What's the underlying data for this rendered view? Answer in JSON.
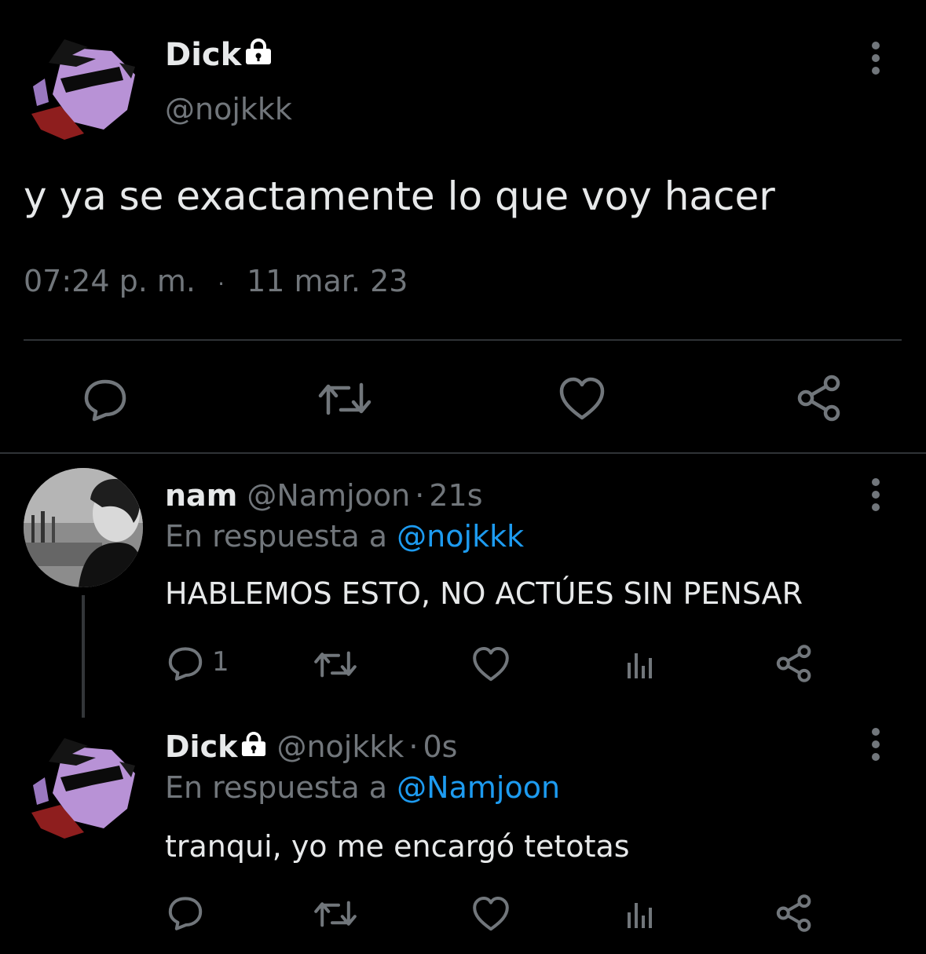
{
  "main_tweet": {
    "display_name": "Dick",
    "handle": "@nojkkk",
    "text": "y ya se exactamente lo que voy hacer",
    "time": "07:24 p. m.",
    "separator": "·",
    "date": "11 mar. 23",
    "avatar_icon": "robin-cartoon-avatar",
    "protected_icon": "lock-icon"
  },
  "main_actions": {
    "icons": [
      "reply-icon",
      "retweet-icon",
      "like-icon",
      "share-icon"
    ]
  },
  "reply1": {
    "display_name": "nam",
    "handle": "@Namjoon",
    "separator": "·",
    "age": "21s",
    "in_reply_prefix": "En respuesta a",
    "in_reply_handle": "@nojkkk",
    "text": "HABLEMOS ESTO, NO ACTÚES SIN PENSAR",
    "reply_count": "1",
    "avatar_icon": "grayscale-photo-avatar"
  },
  "reply2": {
    "display_name": "Dick",
    "handle": "@nojkkk",
    "separator": "·",
    "age": "0s",
    "in_reply_prefix": "En respuesta a",
    "in_reply_handle": "@Namjoon",
    "text": "tranqui, yo me encargó tetotas",
    "avatar_icon": "robin-cartoon-avatar"
  },
  "colors": {
    "background": "#000000",
    "text": "#e7e9ea",
    "muted": "#71767b",
    "link": "#1d9bf0",
    "divider": "#2f3336"
  }
}
